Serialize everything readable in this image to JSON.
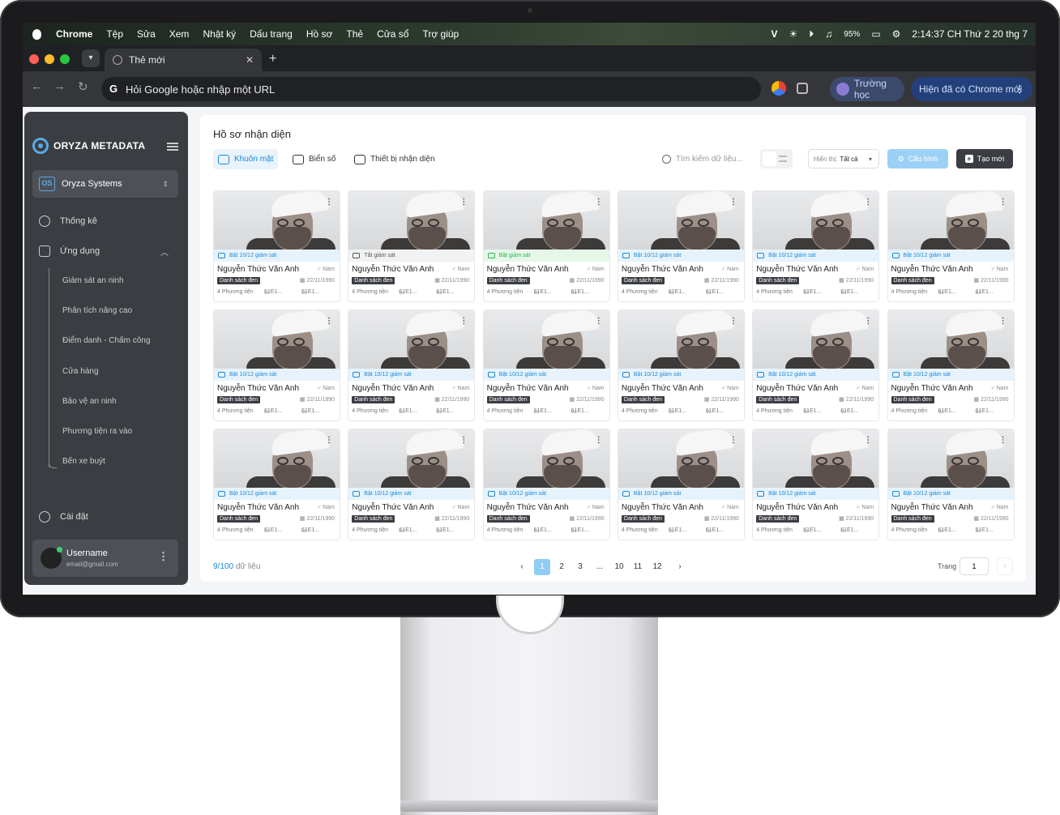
{
  "menubar": {
    "app": "Chrome",
    "items": [
      "Tệp",
      "Sửa",
      "Xem",
      "Nhật ký",
      "Dấu trang",
      "Hồ sơ",
      "Thẻ",
      "Cửa sổ",
      "Trợ giúp"
    ],
    "battery": "95%",
    "clock": "2:14:37 CH Thứ 2 20 thg 7"
  },
  "browser": {
    "tab_title": "Thẻ mới",
    "omnibox_placeholder": "Hỏi Google hoặc nhập một URL",
    "profile": "Trường học",
    "update": "Hiện đã có Chrome mới"
  },
  "sidebar": {
    "brand": "ORYZA METADATA",
    "org": "Oryza Systems",
    "org_abbr": "OS",
    "nav": {
      "stats": "Thống kê",
      "apps": "Ứng dụng",
      "settings": "Cài đặt"
    },
    "subitems": [
      "Giám sát an ninh",
      "Phân tích nâng cao",
      "Điểm danh - Chấm công",
      "Cửa hàng",
      "Bảo vệ an ninh",
      "Phương tiện ra vào",
      "Bến xe buýt"
    ],
    "user": {
      "name": "Username",
      "email": "email@gmail.com"
    }
  },
  "main": {
    "title": "Hồ sơ nhận diện",
    "tabs": [
      "Khuôn mặt",
      "Biển số",
      "Thiết bị nhận diện"
    ],
    "search_placeholder": "Tìm kiếm dữ liệu...",
    "show_label": "Hiển thị:",
    "show_value": "Tất cả",
    "config": "Cấu hình",
    "create": "Tạo mới"
  },
  "card_common": {
    "name": "Nguyễn Thức Văn Anh",
    "gender": "Nam",
    "list": "Danh sách đen",
    "dob": "22/11/1990",
    "vehicles": "4 Phương tiện",
    "code1": "61E1...",
    "code2": "61E1..."
  },
  "card_status": [
    {
      "text": "Bật 10/12 giám sát",
      "kind": "default"
    },
    {
      "text": "Tắt giám sát",
      "kind": "off"
    },
    {
      "text": "Bật giám sát",
      "kind": "on"
    },
    {
      "text": "Bật 10/12 giám sát",
      "kind": "default"
    },
    {
      "text": "Bật 10/12 giám sát",
      "kind": "default"
    },
    {
      "text": "Bật 10/12 giám sát",
      "kind": "default"
    },
    {
      "text": "Bật 10/12 giám sát",
      "kind": "default"
    },
    {
      "text": "Bật 10/12 giám sát",
      "kind": "default"
    },
    {
      "text": "Bật 10/12 giám sát",
      "kind": "default"
    },
    {
      "text": "Bật 10/12 giám sát",
      "kind": "default"
    },
    {
      "text": "Bật 10/12 giám sát",
      "kind": "default"
    },
    {
      "text": "Bật 10/12 giám sát",
      "kind": "default"
    },
    {
      "text": "Bật 10/12 giám sát",
      "kind": "default"
    },
    {
      "text": "Bật 10/12 giám sát",
      "kind": "default"
    },
    {
      "text": "Bật 10/12 giám sát",
      "kind": "default"
    },
    {
      "text": "Bật 10/12 giám sát",
      "kind": "default"
    },
    {
      "text": "Bật 10/12 giám sát",
      "kind": "default"
    },
    {
      "text": "Bật 10/12 giám sát",
      "kind": "default"
    }
  ],
  "footer": {
    "count": "9/100",
    "count_label": "dữ liệu",
    "pages": [
      "1",
      "2",
      "3",
      "...",
      "10",
      "11",
      "12"
    ],
    "current_page": "1",
    "goto_label": "Trang",
    "goto_value": "1"
  }
}
